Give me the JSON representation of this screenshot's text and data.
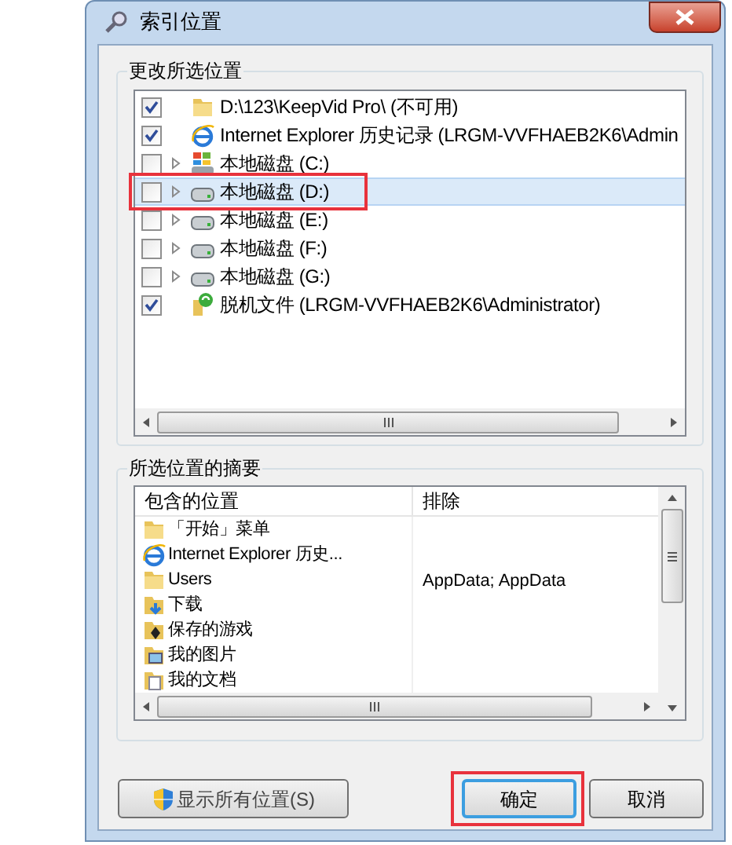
{
  "window": {
    "title": "索引位置"
  },
  "change_locations": {
    "label": "更改所选位置",
    "items": [
      {
        "label": "D:\\123\\KeepVid Pro\\ (不可用)",
        "checked": true,
        "expandable": false,
        "kind": "folder",
        "selected": false,
        "annotated": false
      },
      {
        "label": "Internet Explorer 历史记录 (LRGM-VVFHAEB2K6\\Admin",
        "checked": true,
        "expandable": false,
        "kind": "ie",
        "selected": false,
        "annotated": false
      },
      {
        "label": "本地磁盘 (C:)",
        "checked": false,
        "expandable": true,
        "kind": "system-drive",
        "selected": false,
        "annotated": false
      },
      {
        "label": "本地磁盘 (D:)",
        "checked": false,
        "expandable": true,
        "kind": "drive",
        "selected": true,
        "annotated": true
      },
      {
        "label": "本地磁盘 (E:)",
        "checked": false,
        "expandable": true,
        "kind": "drive",
        "selected": false,
        "annotated": false
      },
      {
        "label": "本地磁盘 (F:)",
        "checked": false,
        "expandable": true,
        "kind": "drive",
        "selected": false,
        "annotated": false
      },
      {
        "label": "本地磁盘 (G:)",
        "checked": false,
        "expandable": true,
        "kind": "drive",
        "selected": false,
        "annotated": false
      },
      {
        "label": "脱机文件 (LRGM-VVFHAEB2K6\\Administrator)",
        "checked": true,
        "expandable": false,
        "kind": "sync-folder",
        "selected": false,
        "annotated": false
      }
    ]
  },
  "summary": {
    "label": "所选位置的摘要",
    "columns": [
      "包含的位置",
      "排除"
    ],
    "rows": [
      {
        "location": "「开始」菜单",
        "kind": "folder"
      },
      {
        "location": "Internet Explorer 历史...",
        "kind": "ie"
      },
      {
        "location": "Users",
        "exclude": "AppData; AppData",
        "kind": "folder"
      },
      {
        "location": "下载",
        "kind": "download-folder"
      },
      {
        "location": "保存的游戏",
        "kind": "games-folder"
      },
      {
        "location": "我的图片",
        "kind": "pictures-folder"
      },
      {
        "location": "我的文档",
        "kind": "documents-folder"
      }
    ]
  },
  "buttons": [
    {
      "kind": "shield",
      "label": "显示所有位置(S)",
      "focused": false,
      "annotated": false
    },
    {
      "kind": "plain",
      "label": "确定",
      "focused": true,
      "annotated": true
    },
    {
      "kind": "plain",
      "label": "取消",
      "focused": false,
      "annotated": false
    }
  ]
}
